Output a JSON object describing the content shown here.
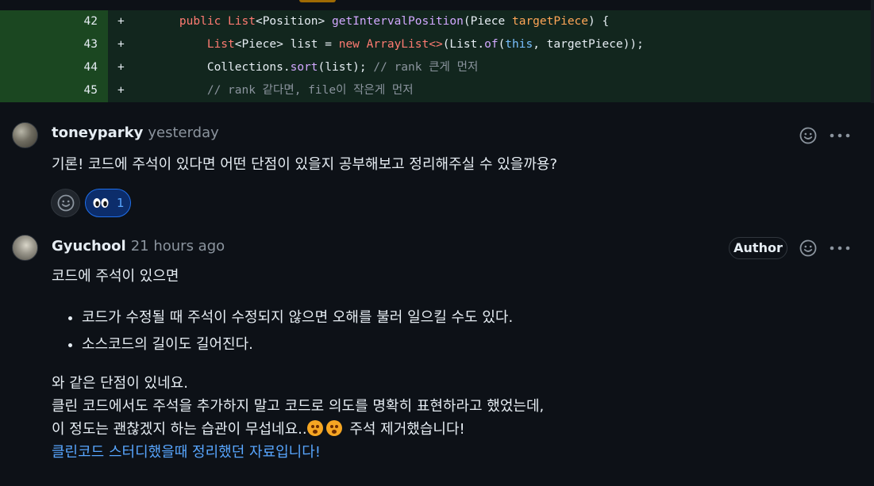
{
  "diff": {
    "lines": [
      {
        "num": "42",
        "marker": "+"
      },
      {
        "num": "43",
        "marker": "+"
      },
      {
        "num": "44",
        "marker": "+"
      },
      {
        "num": "45",
        "marker": "+"
      }
    ],
    "code": {
      "l42": {
        "t1": "public",
        "t2": "List",
        "t3": "<Position> ",
        "t4": "getIntervalPosition",
        "t5": "(Piece ",
        "t6": "targetPiece",
        "t7": ") {"
      },
      "l43": {
        "t1": "List",
        "t2": "<Piece> list = ",
        "t3": "new",
        "t4": "ArrayList",
        "t5": "<>",
        "t6": "(List.",
        "t7": "of",
        "t8": "(",
        "t9": "this",
        "t10": ", targetPiece));"
      },
      "l44": {
        "t1": "Collections.",
        "t2": "sort",
        "t3": "(list); ",
        "t4": "// rank 큰게 먼저"
      },
      "l45": {
        "t1": "// rank 같다면, file이 작은게 먼저"
      }
    }
  },
  "comments": [
    {
      "author": "toneyparky",
      "time": "yesterday",
      "body": "기론! 코드에 주석이 있다면 어떤 단점이 있을지 공부해보고 정리해주실 수 있을까용?",
      "reactions": [
        {
          "icon": "eyes-icon",
          "count": "1"
        }
      ]
    },
    {
      "author": "Gyuchool",
      "time": "21 hours ago",
      "badge": "Author",
      "intro": "코드에 주석이 있으면",
      "bullets": [
        "코드가 수정될 때 주석이 수정되지 않으면 오해를 불러 일으킬 수도 있다.",
        "소스코드의 길이도 길어진다."
      ],
      "p1": "와 같은 단점이 있네요.",
      "p2": "클린 코드에서도 주석을 추가하지 말고 코드로 의도를 명확히 표현하라고 했었는데,",
      "p3a": "이 정도는 괜찮겠지 하는 습관이 무섭네요..",
      "p3b": "주석 제거했습니다!",
      "link": "클린코드 스터디했을때 정리했던 자료입니다!"
    }
  ],
  "colors": {
    "accent": "#58a6ff",
    "diff_add": "#12261e",
    "gutter_add": "#1b4721"
  }
}
